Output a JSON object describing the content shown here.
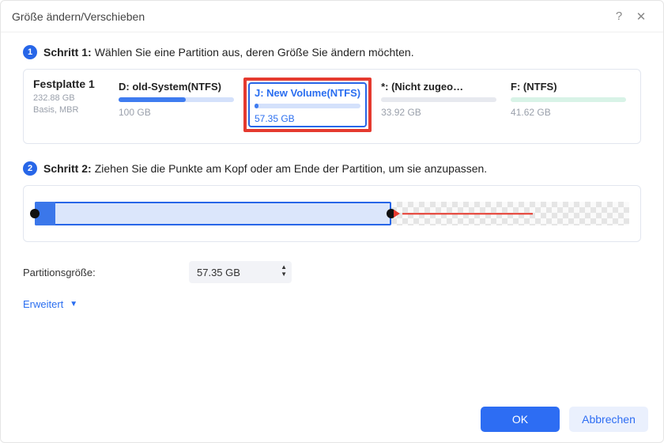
{
  "window": {
    "title": "Größe ändern/Verschieben"
  },
  "step1": {
    "num": "1",
    "label_bold": "Schritt 1:",
    "label_rest": "Wählen Sie eine Partition aus, deren Größe Sie ändern möchten."
  },
  "disk": {
    "name": "Festplatte 1",
    "capacity": "232.88 GB",
    "scheme": "Basis, MBR"
  },
  "partitions": [
    {
      "name": "D: old-System(NTFS)",
      "size": "100 GB",
      "fill_pct": 58,
      "color": "#3f7cf0",
      "track": "#d4e1fb",
      "selected": false,
      "highlighted": false
    },
    {
      "name": "J: New Volume(NTFS)",
      "size": "57.35 GB",
      "fill_pct": 4,
      "color": "#3f7cf0",
      "track": "#d4e1fb",
      "selected": true,
      "highlighted": true
    },
    {
      "name": "*: (Nicht zugeo…",
      "size": "33.92 GB",
      "fill_pct": 0,
      "color": "#9fa6b2",
      "track": "#e7e9ef",
      "selected": false,
      "highlighted": false
    },
    {
      "name": "F: (NTFS)",
      "size": "41.62 GB",
      "fill_pct": 0,
      "color": "#7fd9b4",
      "track": "#d8f3e7",
      "selected": false,
      "highlighted": false
    }
  ],
  "step2": {
    "num": "2",
    "label_bold": "Schritt 2:",
    "label_rest": "Ziehen Sie die Punkte am Kopf oder am Ende der Partition, um sie anzupassen."
  },
  "slider": {
    "alloc_pct": 60,
    "used_pct": 3.4
  },
  "size_field": {
    "label": "Partitionsgröße:",
    "value": "57.35 GB"
  },
  "advanced": {
    "label": "Erweitert"
  },
  "buttons": {
    "ok": "OK",
    "cancel": "Abbrechen"
  }
}
